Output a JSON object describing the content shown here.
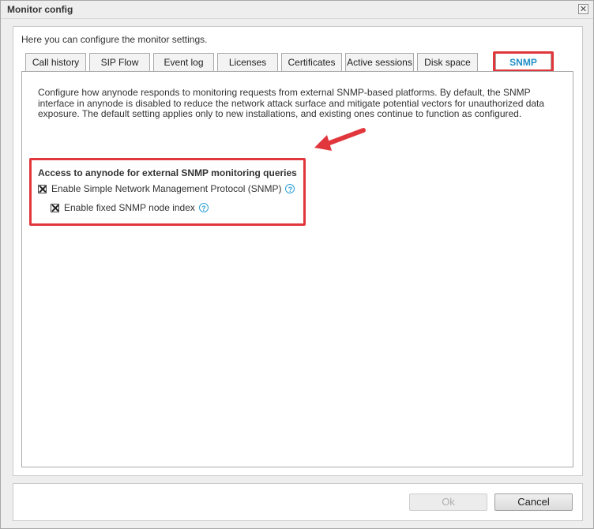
{
  "window": {
    "title": "Monitor config",
    "close_label": "✕"
  },
  "intro": "Here you can configure the monitor settings.",
  "tabs": [
    {
      "label": "Call history"
    },
    {
      "label": "SIP Flow"
    },
    {
      "label": "Event log"
    },
    {
      "label": "Licenses"
    },
    {
      "label": "Certificates"
    },
    {
      "label": "Active sessions"
    },
    {
      "label": "Disk space"
    },
    {
      "label": "SNMP",
      "active": true
    }
  ],
  "snmp": {
    "description_lines": [
      "Configure how anynode responds to monitoring requests from external SNMP-based platforms. By default, the SNMP",
      "interface in anynode is disabled to reduce the network attack surface and mitigate potential vectors for unauthorized data",
      "exposure. The default setting applies only to new installations, and existing ones continue to function as configured."
    ],
    "section_title": "Access to anynode for external SNMP monitoring queries",
    "enable_snmp_label": "Enable Simple Network Management Protocol (SNMP)",
    "enable_snmp_checked": true,
    "fixed_index_label": "Enable fixed SNMP node index",
    "fixed_index_checked": true,
    "help_glyph": "?"
  },
  "footer": {
    "ok_label": "Ok",
    "ok_enabled": false,
    "cancel_label": "Cancel"
  },
  "colors": {
    "highlight": "#e0363c",
    "active_tab": "#1e8fc6",
    "help": "#2d9fd6"
  },
  "icons": {
    "close": "close-icon",
    "help": "help-icon",
    "checkbox": "checked-checkbox-icon",
    "annotation": "arrow-icon"
  }
}
